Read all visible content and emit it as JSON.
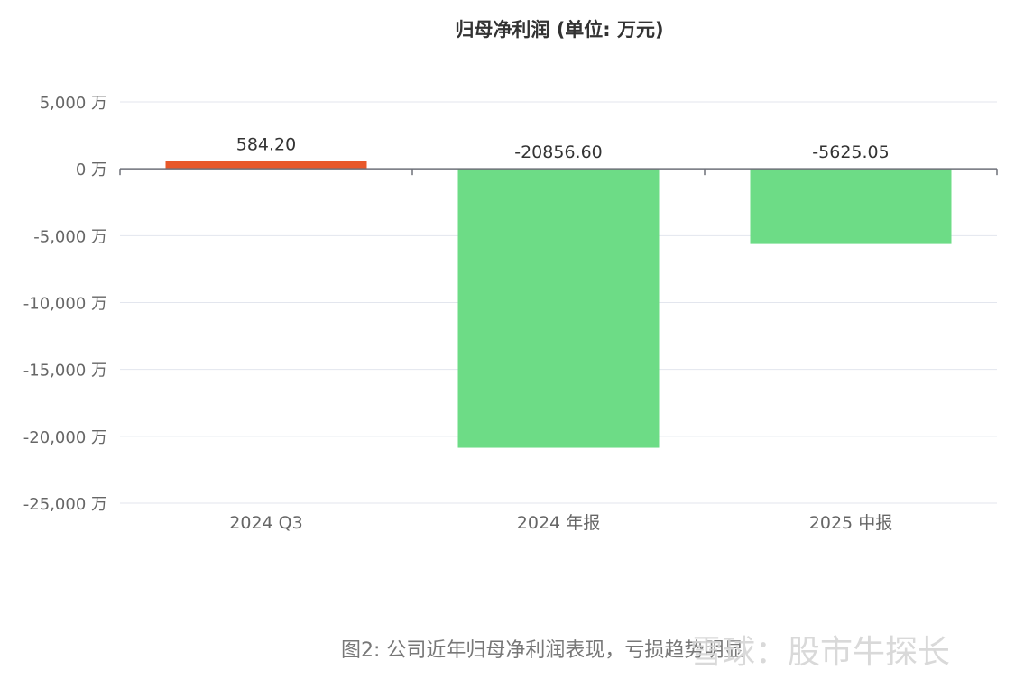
{
  "chart_data": {
    "type": "bar",
    "title": "归母净利润 (单位: 万元)",
    "categories": [
      "2024 Q3",
      "2024 年报",
      "2025 中报"
    ],
    "values": [
      584.2,
      -20856.6,
      -5625.05
    ],
    "value_labels": [
      "584.20",
      "-20856.60",
      "-5625.05"
    ],
    "bar_colors": [
      "#e8582a",
      "#6ddc86",
      "#6ddc86"
    ],
    "ylim": [
      -25000,
      5000
    ],
    "y_ticks": [
      5000,
      0,
      -5000,
      -10000,
      -15000,
      -20000,
      -25000
    ],
    "y_tick_labels": [
      "5,000 万",
      "0 万",
      "-5,000 万",
      "-10,000 万",
      "-15,000 万",
      "-20,000 万",
      "-25,000 万"
    ],
    "xlabel": "",
    "ylabel": "",
    "grid": true,
    "legend": null
  },
  "caption": "图2: 公司近年归母净利润表现，亏损趋势明显",
  "watermark": "雪球：股市牛探长",
  "colors": {
    "positive": "#e8582a",
    "negative": "#6ddc86",
    "grid": "#e3e6ee",
    "axis": "#6e7079",
    "tick_text": "#666666",
    "label_text": "#333333"
  }
}
